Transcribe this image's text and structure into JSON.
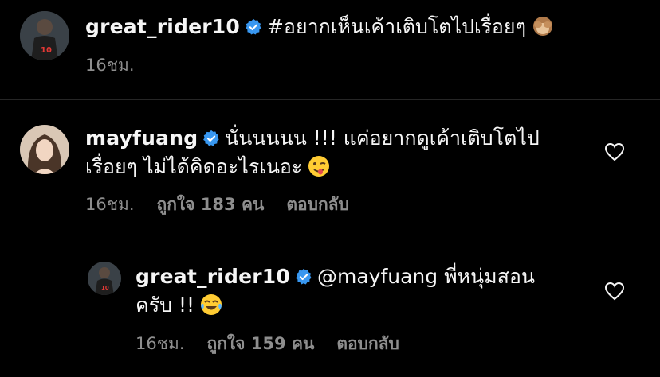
{
  "caption": {
    "username": "great_rider10",
    "text": "#อยากเห็นเค้าเติบโตไปเรื่อยๆ",
    "emoji": "see-no-evil-monkey",
    "time": "16ชม."
  },
  "comments": [
    {
      "username": "mayfuang",
      "text_line1": "นั่นนนนน !!! แค่อยากดูเค้าเติบโตไป",
      "text_line2": "เรื่อยๆ ไม่ได้คิดอะไรเนอะ",
      "emoji": "winking-tongue-face",
      "time": "16ชม.",
      "likes": "ถูกใจ 183 คน",
      "reply_label": "ตอบกลับ"
    },
    {
      "username": "great_rider10",
      "text_line1": "@mayfuang พี่หนุ่มสอน",
      "text_line2": "ครับ !!",
      "emoji": "tears-of-joy-face",
      "time": "16ชม.",
      "likes": "ถูกใจ 159 คน",
      "reply_label": "ตอบกลับ"
    }
  ],
  "colors": {
    "background": "#000000",
    "text": "#f5f5f5",
    "secondary": "#8e8e8e",
    "verified": "#3897f0"
  }
}
